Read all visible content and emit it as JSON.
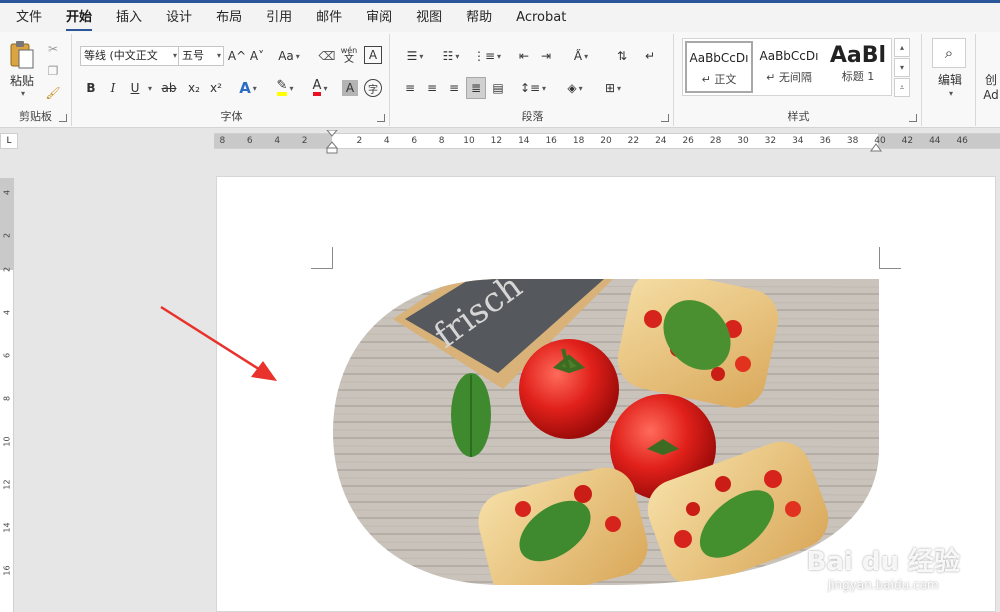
{
  "tabs": [
    "文件",
    "开始",
    "插入",
    "设计",
    "布局",
    "引用",
    "邮件",
    "审阅",
    "视图",
    "帮助",
    "Acrobat"
  ],
  "active_tab_index": 1,
  "clipboard": {
    "paste_label": "粘贴",
    "group_label": "剪贴板"
  },
  "font": {
    "font_name": "等线 (中文正文",
    "font_size": "五号",
    "group_label": "字体",
    "size_up": "A^",
    "size_down": "A˅",
    "change_case": "Aa",
    "phonetic_top": "wén",
    "phonetic_bottom": "文",
    "border_char": "A",
    "bold": "B",
    "italic": "I",
    "underline": "U",
    "strike": "ab",
    "subscript": "x₂",
    "superscript": "x²",
    "effects": "A",
    "font_color": "A",
    "shading": "A",
    "enclose": "字"
  },
  "paragraph": {
    "group_label": "段落"
  },
  "styles": {
    "group_label": "样式",
    "cards": [
      {
        "sample": "AaBbCcDı",
        "name": "↵ 正文"
      },
      {
        "sample": "AaBbCcDı",
        "name": "↵ 无间隔"
      },
      {
        "sample": "AaBl",
        "name": "标题 1"
      }
    ]
  },
  "editing": {
    "label": "编辑"
  },
  "create": {
    "label_line1": "创",
    "label_line2": "Ad"
  },
  "ruler": {
    "h_ticks_left": [
      "8",
      "6",
      "4",
      "2"
    ],
    "h_ticks_right": [
      "2",
      "4",
      "6",
      "8",
      "10",
      "12",
      "14",
      "16",
      "18",
      "20",
      "22",
      "24",
      "26",
      "28",
      "30",
      "32",
      "34",
      "36",
      "38",
      "40",
      "42",
      "44",
      "46"
    ],
    "v_ticks_top": [
      "4",
      "2"
    ],
    "v_ticks_bottom": [
      "2",
      "4",
      "6",
      "8",
      "10",
      "12",
      "14",
      "16"
    ]
  },
  "photo": {
    "chalk_text": "frisch"
  },
  "watermark": {
    "brand": "Bai du 经验",
    "url": "jingyan.baidu.com"
  },
  "colors": {
    "accent": "#2b579a",
    "arrow": "#e8322b",
    "highlight": "#ffff00",
    "font_color_bar": "#e81123"
  }
}
